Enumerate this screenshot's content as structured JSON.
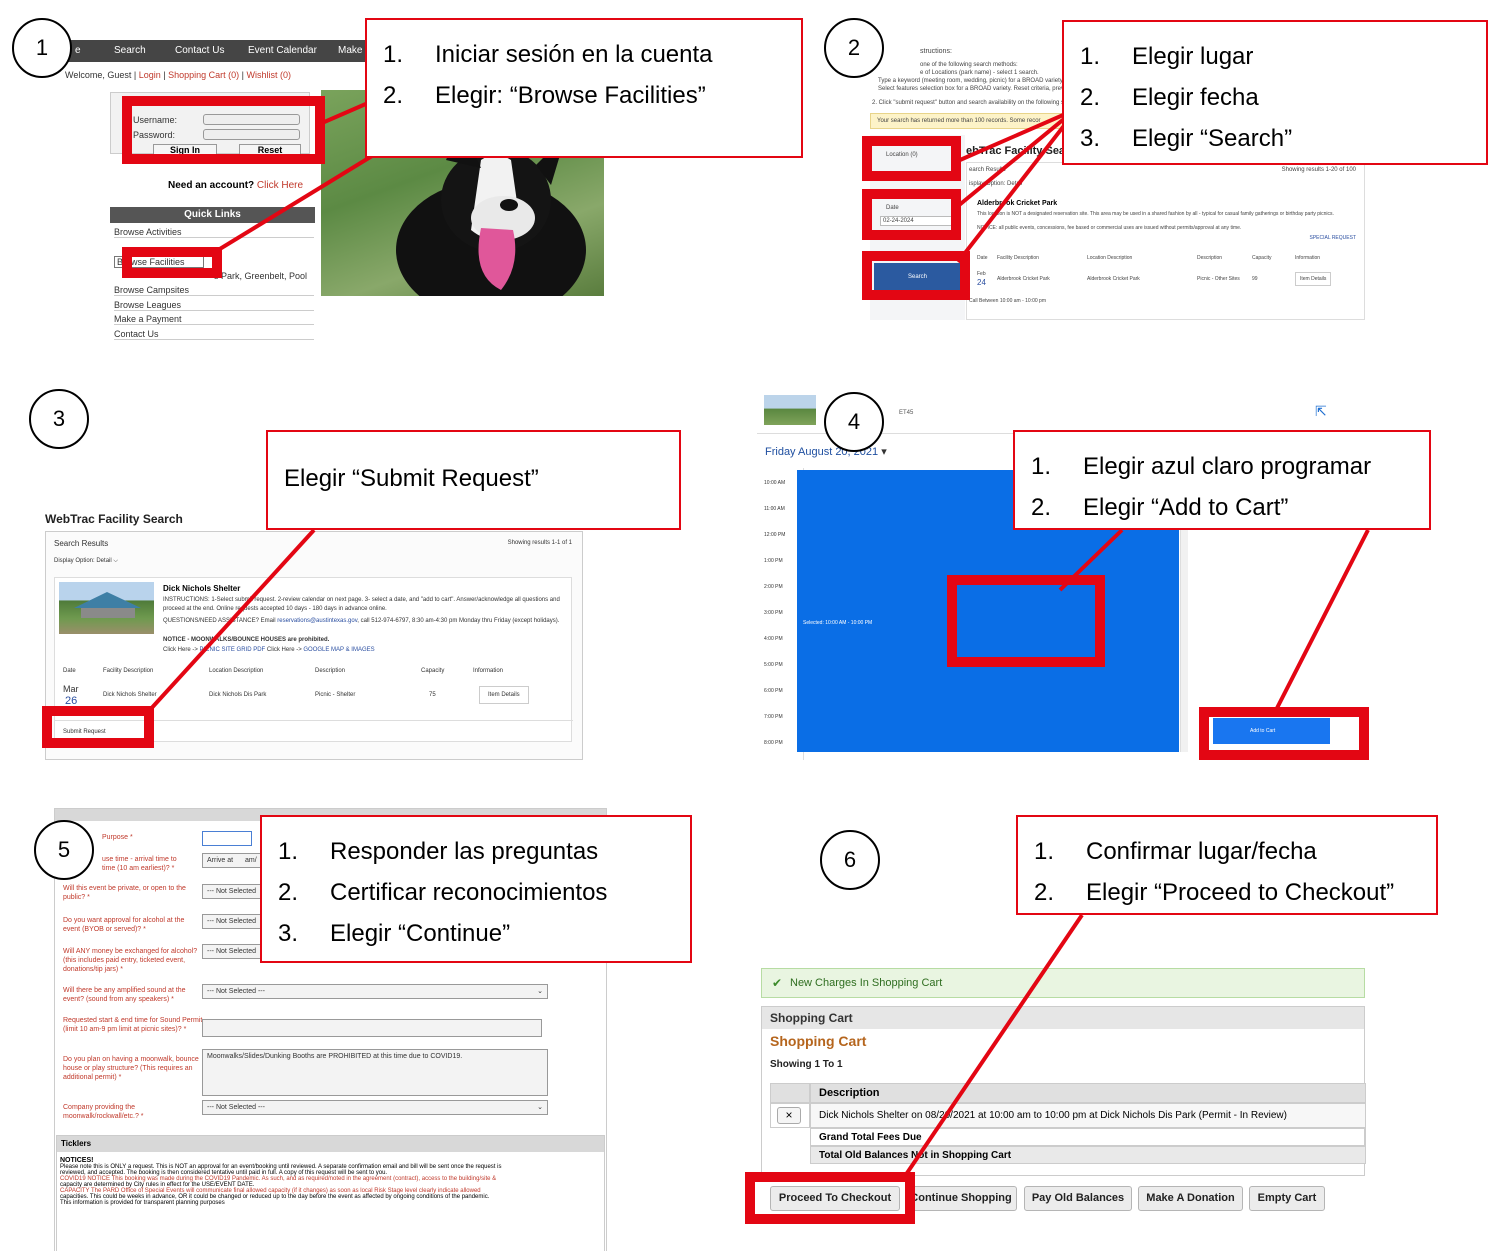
{
  "steps": [
    "1",
    "2",
    "3",
    "4",
    "5",
    "6"
  ],
  "callouts": {
    "c1": [
      "Iniciar sesión en la cuenta",
      "Elegir: “Browse  Facilities”"
    ],
    "c2": [
      "Elegir lugar",
      "Elegir fecha",
      "Elegir “Search”"
    ],
    "c3": "Elegir “Submit Request”",
    "c4": [
      "Elegir azul claro programar",
      "Elegir “Add to Cart”"
    ],
    "c5": [
      "Responder las preguntas",
      "Certificar reconocimientos",
      "Elegir “Continue”"
    ],
    "c6": [
      "Confirmar lugar/fecha",
      "Elegir “Proceed to Checkout”"
    ],
    "item_numbers": [
      "1.",
      "2.",
      "3."
    ]
  },
  "highlight_color": "#e30613",
  "panel1": {
    "nav": [
      "e",
      "Search",
      "Contact Us",
      "Event Calendar",
      "Make"
    ],
    "welcome": "Welcome, Guest |",
    "login_link": "Login",
    "cart_link": "Shopping Cart (0)",
    "wishlist_link": "Wishlist (0)",
    "username_label": "Username:",
    "password_label": "Password:",
    "sign_in": "Sign In",
    "reset": "Reset",
    "need_account": "Need an account?",
    "click_here": "Click Here",
    "quick_links": "Quick Links",
    "links": [
      "Browse Activities",
      "Browse Facilities",
      "Browse Campsites",
      "Browse Leagues",
      "Make a Payment",
      "Contact Us"
    ],
    "obscured_link_tail": "s Park, Greenbelt, Pool"
  },
  "panel2": {
    "instructions": "structions:",
    "instr_lines": [
      "one of the following search methods:",
      "e of Locations (park name) - select 1 search.",
      "Type a keyword (meeting room, wedding, picnic) for a BROAD variety of options",
      "Select features selection box for a BROAD variety. Reset criteria, preview a more s"
    ],
    "instr_step2": "2. Click \"submit request\" button and search availability on the following screen. A",
    "notice": "Your search has returned more than 100 records. Some recor",
    "location": "Location (0)",
    "date_label": "Date",
    "date_value": "02-24-2024",
    "search": "Search",
    "heading": "ebTrac Facility Search",
    "results": "earch Results",
    "showing": "Showing results 1-20 of 100",
    "display": "isplay Option: Detail",
    "park": "Alderbrook Cricket Park",
    "desc_line": "This location is NOT a designated reservation site. This area may be used in a shared fashion by all - typical for casual family gatherings or birthday party picnics.",
    "notice_line": "NOTICE: all public events, concessions, fee based or commercial uses are issued without permits/approval at any time.",
    "special_request": "SPECIAL REQUEST",
    "columns": [
      "Date",
      "Facility Description",
      "Location Description",
      "Description",
      "Capacity",
      "Information"
    ],
    "row": [
      "Feb",
      "24",
      "Alderbrook Cricket Park",
      "Alderbrook Cricket Park",
      "Picnic - Other Sites",
      "99",
      "Item Details"
    ],
    "footer": "Call Between    10:00 am - 10:00 pm"
  },
  "panel3": {
    "title": "WebTrac Facility Search",
    "search_results": "Search Results",
    "showing": "Showing results 1-1 of 1",
    "display_option": "Display Option:  Detail  ⌵",
    "shelter": "Dick Nichols Shelter",
    "instructions": "INSTRUCTIONS: 1-Select submit request. 2-review calendar on next page. 3- select a date, and \"add to cart\". Answer/acknowledge all questions and proceed at the end. Online requests accepted 10 days - 180 days in advance online.",
    "questions_prefix": "QUESTIONS/NEED ASSISTANCE? Email",
    "email": "reservations@austintexas.gov",
    "questions_suffix": ", call 512-974-6797, 8:30 am-4:30 pm Monday thru Friday (except holidays).",
    "notice": "NOTICE - MOONWALKS/BOUNCE HOUSES are prohibited.",
    "click_here1": "Click Here ->",
    "pdf_link": "PICNIC SITE GRID PDF",
    "click_here2": " Click Here ->",
    "maps_link": "GOOGLE MAP & IMAGES",
    "columns": [
      "Date",
      "Facility Description",
      "Location Description",
      "Description",
      "Capacity",
      "Information"
    ],
    "row": [
      "Mar",
      "26",
      "Dick Nichols Shelter",
      "Dick Nichols Dis Park",
      "Picnic - Shelter",
      "75",
      "Item Details"
    ],
    "submit": "Submit Request"
  },
  "panel4": {
    "header_text": "ET45",
    "day": "Friday",
    "date": "August 20, 2021",
    "times": [
      "10:00 AM",
      "11:00 AM",
      "12:00 PM",
      "1:00 PM",
      "2:00 PM",
      "3:00 PM",
      "4:00 PM",
      "5:00 PM",
      "6:00 PM",
      "7:00 PM",
      "8:00 PM"
    ],
    "selected": "Selected: 10:00 AM - 10:00 PM",
    "add_to_cart": "Add to Cart",
    "calendar_color": "#0a6ee6"
  },
  "panel5": {
    "questions": [
      "Purpose *",
      "use time - arrival time to\ntime (10 am earliest)? *",
      "Will this event be private, or open to the public? *",
      "Do you want approval for alcohol at the event (BYOB or served)? *",
      "Will ANY money be exchanged for alcohol? (this includes paid entry, ticketed event, donations/tip jars) *",
      "Will there be any amplified sound at the event? (sound from any speakers) *",
      "Requested start & end time for Sound Permit (limit 10 am-9 pm limit at picnic sites)? *",
      "Do you plan on having a moonwalk, bounce house or play structure? (This requires an additional permit) *",
      "Company providing the moonwalk/rockwall/etc.? *"
    ],
    "arrive_at": "Arrive at",
    "arrive_suffix": "am/",
    "not_selected": "--- Not Selected ---",
    "not_selected_short": "--- Not Selected",
    "moonwalk_text": "Moonwalks/Slides/Dunking Booths are PROHIBITED at this time due to COVID19.",
    "ticklers": "Ticklers",
    "notices_title": "NOTICES!",
    "notice_lines": [
      "Please note this is ONLY a request. This is NOT an approval for an event/booking until reviewed. A separate confirmation email and bill will be sent once the request is",
      "reviewed, and accepted. The booking is then considered tentative until paid in full. A copy of this request will be sent to you.",
      "COVID19 NOTICE This booking was made during the COVID19 Pandemic. As such, and as required/noted in the agreement (contract), access to the building/site &",
      "capacity are determined by City rules in effect for the USE/EVENT DATE.",
      "CAPACITY The PARD Office of Special Events will communicate final allowed capacity (if it changes) as soon as local Risk Stage level clearly indicate allowed",
      "capacities. This could be weeks in advance, OR it could be changed or reduced up to the day before the event as affected by ongoing conditions of the pandemic.",
      "This information is provided for transparent planning purposes"
    ]
  },
  "panel6": {
    "alert": "New Charges In Shopping Cart",
    "header": "Shopping Cart",
    "title": "Shopping Cart",
    "showing": "Showing 1 To 1",
    "col_description": "Description",
    "remove": "×",
    "item": "Dick Nichols Shelter on 08/20/2021 at 10:00 am to 10:00 pm at Dick Nichols Dis Park (Permit - In Review)",
    "grand_total": "Grand Total Fees Due",
    "old_balances": "Total Old Balances Not in Shopping Cart",
    "buttons": [
      "Proceed To Checkout",
      "Continue Shopping",
      "Pay Old Balances",
      "Make A Donation",
      "Empty Cart"
    ],
    "alert_color": "#e9f5e1",
    "title_color": "#b5651d"
  }
}
